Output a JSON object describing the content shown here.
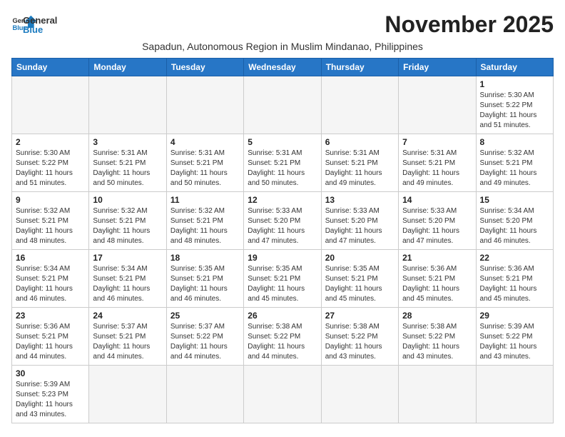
{
  "logo": {
    "text_general": "General",
    "text_blue": "Blue"
  },
  "header": {
    "month_year": "November 2025",
    "subtitle": "Sapadun, Autonomous Region in Muslim Mindanao, Philippines"
  },
  "weekdays": [
    "Sunday",
    "Monday",
    "Tuesday",
    "Wednesday",
    "Thursday",
    "Friday",
    "Saturday"
  ],
  "weeks": [
    [
      {
        "day": "",
        "info": ""
      },
      {
        "day": "",
        "info": ""
      },
      {
        "day": "",
        "info": ""
      },
      {
        "day": "",
        "info": ""
      },
      {
        "day": "",
        "info": ""
      },
      {
        "day": "",
        "info": ""
      },
      {
        "day": "1",
        "info": "Sunrise: 5:30 AM\nSunset: 5:22 PM\nDaylight: 11 hours and 51 minutes."
      }
    ],
    [
      {
        "day": "2",
        "info": "Sunrise: 5:30 AM\nSunset: 5:22 PM\nDaylight: 11 hours and 51 minutes."
      },
      {
        "day": "3",
        "info": "Sunrise: 5:31 AM\nSunset: 5:21 PM\nDaylight: 11 hours and 50 minutes."
      },
      {
        "day": "4",
        "info": "Sunrise: 5:31 AM\nSunset: 5:21 PM\nDaylight: 11 hours and 50 minutes."
      },
      {
        "day": "5",
        "info": "Sunrise: 5:31 AM\nSunset: 5:21 PM\nDaylight: 11 hours and 50 minutes."
      },
      {
        "day": "6",
        "info": "Sunrise: 5:31 AM\nSunset: 5:21 PM\nDaylight: 11 hours and 49 minutes."
      },
      {
        "day": "7",
        "info": "Sunrise: 5:31 AM\nSunset: 5:21 PM\nDaylight: 11 hours and 49 minutes."
      },
      {
        "day": "8",
        "info": "Sunrise: 5:32 AM\nSunset: 5:21 PM\nDaylight: 11 hours and 49 minutes."
      }
    ],
    [
      {
        "day": "9",
        "info": "Sunrise: 5:32 AM\nSunset: 5:21 PM\nDaylight: 11 hours and 48 minutes."
      },
      {
        "day": "10",
        "info": "Sunrise: 5:32 AM\nSunset: 5:21 PM\nDaylight: 11 hours and 48 minutes."
      },
      {
        "day": "11",
        "info": "Sunrise: 5:32 AM\nSunset: 5:21 PM\nDaylight: 11 hours and 48 minutes."
      },
      {
        "day": "12",
        "info": "Sunrise: 5:33 AM\nSunset: 5:20 PM\nDaylight: 11 hours and 47 minutes."
      },
      {
        "day": "13",
        "info": "Sunrise: 5:33 AM\nSunset: 5:20 PM\nDaylight: 11 hours and 47 minutes."
      },
      {
        "day": "14",
        "info": "Sunrise: 5:33 AM\nSunset: 5:20 PM\nDaylight: 11 hours and 47 minutes."
      },
      {
        "day": "15",
        "info": "Sunrise: 5:34 AM\nSunset: 5:20 PM\nDaylight: 11 hours and 46 minutes."
      }
    ],
    [
      {
        "day": "16",
        "info": "Sunrise: 5:34 AM\nSunset: 5:21 PM\nDaylight: 11 hours and 46 minutes."
      },
      {
        "day": "17",
        "info": "Sunrise: 5:34 AM\nSunset: 5:21 PM\nDaylight: 11 hours and 46 minutes."
      },
      {
        "day": "18",
        "info": "Sunrise: 5:35 AM\nSunset: 5:21 PM\nDaylight: 11 hours and 46 minutes."
      },
      {
        "day": "19",
        "info": "Sunrise: 5:35 AM\nSunset: 5:21 PM\nDaylight: 11 hours and 45 minutes."
      },
      {
        "day": "20",
        "info": "Sunrise: 5:35 AM\nSunset: 5:21 PM\nDaylight: 11 hours and 45 minutes."
      },
      {
        "day": "21",
        "info": "Sunrise: 5:36 AM\nSunset: 5:21 PM\nDaylight: 11 hours and 45 minutes."
      },
      {
        "day": "22",
        "info": "Sunrise: 5:36 AM\nSunset: 5:21 PM\nDaylight: 11 hours and 45 minutes."
      }
    ],
    [
      {
        "day": "23",
        "info": "Sunrise: 5:36 AM\nSunset: 5:21 PM\nDaylight: 11 hours and 44 minutes."
      },
      {
        "day": "24",
        "info": "Sunrise: 5:37 AM\nSunset: 5:21 PM\nDaylight: 11 hours and 44 minutes."
      },
      {
        "day": "25",
        "info": "Sunrise: 5:37 AM\nSunset: 5:22 PM\nDaylight: 11 hours and 44 minutes."
      },
      {
        "day": "26",
        "info": "Sunrise: 5:38 AM\nSunset: 5:22 PM\nDaylight: 11 hours and 44 minutes."
      },
      {
        "day": "27",
        "info": "Sunrise: 5:38 AM\nSunset: 5:22 PM\nDaylight: 11 hours and 43 minutes."
      },
      {
        "day": "28",
        "info": "Sunrise: 5:38 AM\nSunset: 5:22 PM\nDaylight: 11 hours and 43 minutes."
      },
      {
        "day": "29",
        "info": "Sunrise: 5:39 AM\nSunset: 5:22 PM\nDaylight: 11 hours and 43 minutes."
      }
    ],
    [
      {
        "day": "30",
        "info": "Sunrise: 5:39 AM\nSunset: 5:23 PM\nDaylight: 11 hours and 43 minutes."
      },
      {
        "day": "",
        "info": ""
      },
      {
        "day": "",
        "info": ""
      },
      {
        "day": "",
        "info": ""
      },
      {
        "day": "",
        "info": ""
      },
      {
        "day": "",
        "info": ""
      },
      {
        "day": "",
        "info": ""
      }
    ]
  ]
}
